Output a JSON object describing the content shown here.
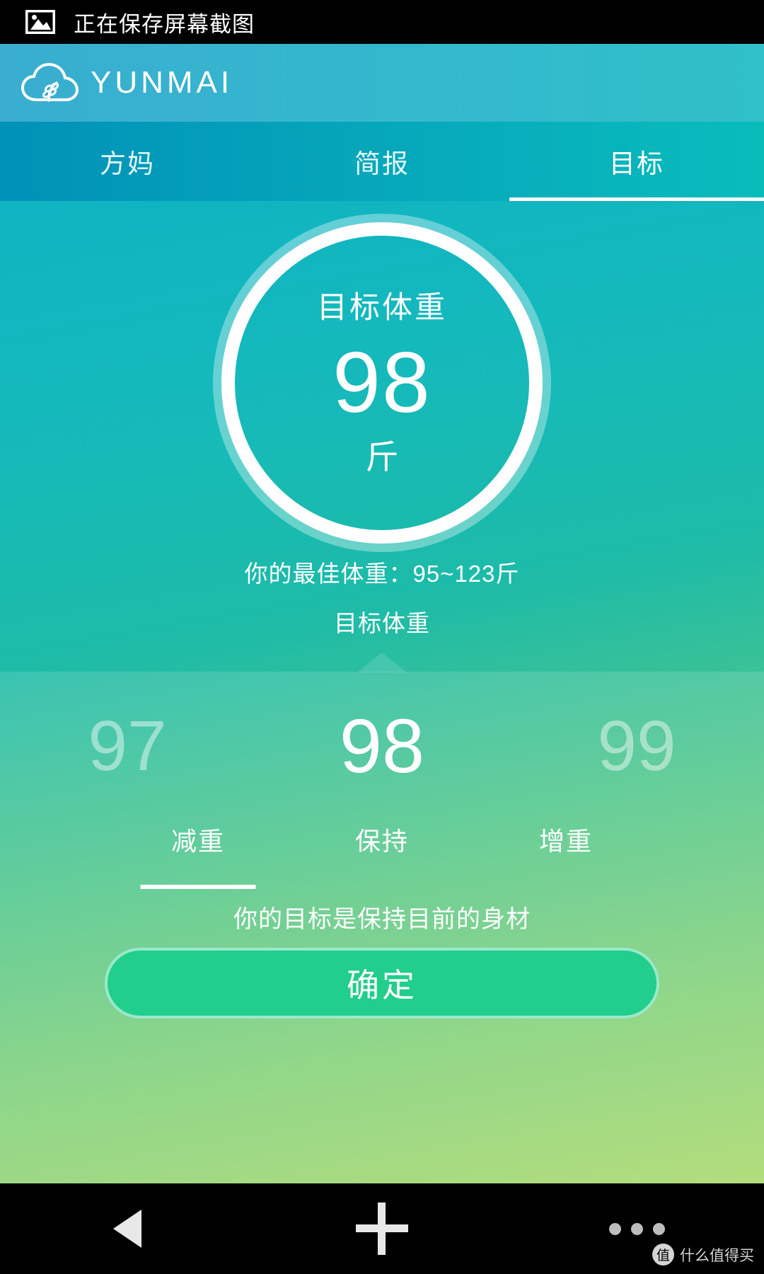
{
  "status_bar": {
    "icon": "image-icon",
    "text": "正在保存屏幕截图"
  },
  "brand": {
    "logo_icon": "cloud-wheat-logo-icon",
    "name": "YUNMAI"
  },
  "tabs": [
    {
      "label": "方妈",
      "active": false
    },
    {
      "label": "简报",
      "active": false
    },
    {
      "label": "目标",
      "active": true
    }
  ],
  "goal_circle": {
    "title": "目标体重",
    "value": "98",
    "unit": "斤"
  },
  "best_weight_text": "你的最佳体重：95~123斤",
  "picker_caption": "目标体重",
  "picker": {
    "prev": "97",
    "current": "98",
    "next": "99"
  },
  "modes": [
    {
      "label": "减重",
      "active": true
    },
    {
      "label": "保持",
      "active": false
    },
    {
      "label": "增重",
      "active": false
    }
  ],
  "goal_hint": "你的目标是保持目前的身材",
  "confirm_button": "确定",
  "nav_bar": {
    "back": "back-triangle-icon",
    "home": "plus-icon",
    "recents": "three-dots-icon"
  },
  "watermark": {
    "badge": "值",
    "text": "什么值得买"
  },
  "colors": {
    "brand_bar_start": "#3aadd0",
    "brand_bar_end": "#2fc0c9",
    "tabs_start": "#0091b8",
    "tabs_end": "#09bcbc",
    "body_start": "#0fb3c2",
    "body_end": "#a8d86a",
    "confirm_green": "#21ce8b",
    "white": "#ffffff"
  }
}
